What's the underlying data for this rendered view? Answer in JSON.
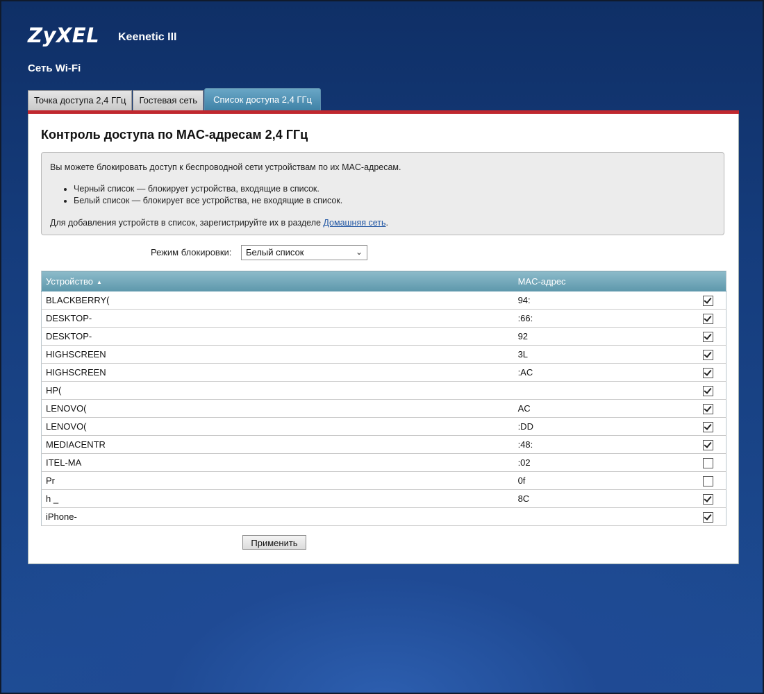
{
  "brand": {
    "logo": "ZyXEL",
    "model": "Keenetic III"
  },
  "section_title": "Сеть Wi-Fi",
  "tabs": [
    {
      "label": "Точка доступа 2,4 ГГц",
      "active": false
    },
    {
      "label": "Гостевая сеть",
      "active": false
    },
    {
      "label": "Список доступа 2,4 ГГц",
      "active": true
    }
  ],
  "panel": {
    "title": "Контроль доступа по MAC-адресам 2,4 ГГц",
    "info": {
      "intro": "Вы можете блокировать доступ к беспроводной сети устройствам по их MAC-адресам.",
      "bullets": [
        "Черный список — блокирует устройства, входящие в список.",
        "Белый список — блокирует все устройства, не входящие в список."
      ],
      "footer_text": "Для добавления устройств в список, зарегистрируйте их в разделе ",
      "footer_link": "Домашняя сеть",
      "footer_end": "."
    },
    "mode_label": "Режим блокировки:",
    "mode_value": "Белый список"
  },
  "table": {
    "headers": {
      "device": "Устройство",
      "mac": "MAC-адрес"
    },
    "rows": [
      {
        "device": "BLACKBERRY(",
        "mac": "94:",
        "checked": true
      },
      {
        "device": "DESKTOP-",
        "mac": ":66:",
        "checked": true
      },
      {
        "device": "DESKTOP-",
        "mac": "92",
        "checked": true
      },
      {
        "device": "HIGHSCREEN",
        "mac": "3L",
        "checked": true
      },
      {
        "device": "HIGHSCREEN",
        "mac": ":AC",
        "checked": true
      },
      {
        "device": "HP(",
        "mac": "",
        "checked": true
      },
      {
        "device": "LENOVO(",
        "mac": "AC",
        "checked": true
      },
      {
        "device": "LENOVO(",
        "mac": ":DD",
        "checked": true
      },
      {
        "device": "MEDIACENTR",
        "mac": ":48:",
        "checked": true
      },
      {
        "device": "ITEL-MA",
        "mac": ":02",
        "checked": false
      },
      {
        "device": "Pr",
        "mac": "0f",
        "checked": false
      },
      {
        "device": "h _",
        "mac": "8C",
        "checked": true
      },
      {
        "device": "iPhone-",
        "mac": "",
        "checked": true
      }
    ]
  },
  "apply_label": "Применить",
  "icons": {
    "sort": "sort-ascending-icon",
    "dropdown": "chevron-down-icon",
    "checkbox": "checkbox-icon"
  },
  "colors": {
    "accent_red": "#c0282f",
    "table_header": "#6ea6b8",
    "tab_active": "#4f8fb2"
  }
}
